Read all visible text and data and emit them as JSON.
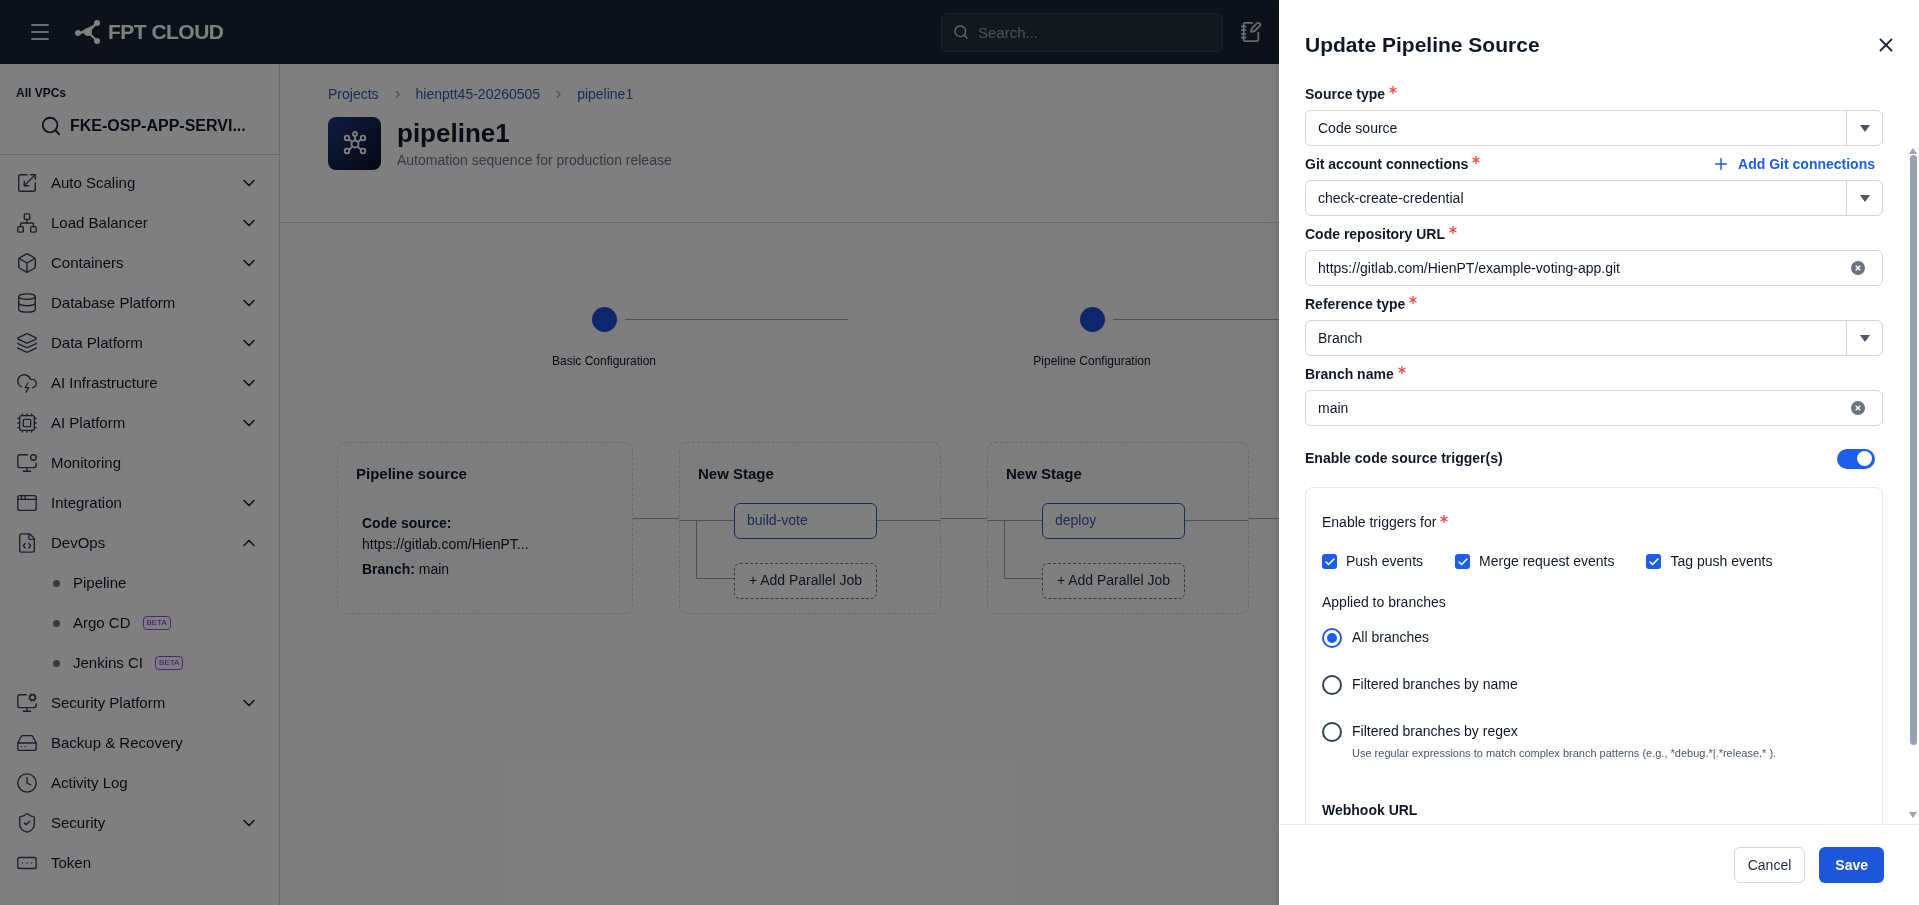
{
  "header": {
    "logo": "FPT CLOUD",
    "search": {
      "placeholder": "Search..."
    }
  },
  "sidebar": {
    "vpc_label": "All VPCs",
    "vpc_name": "FKE-OSP-APP-SERVI...",
    "items": [
      {
        "label": "Auto Scaling",
        "expanded": false
      },
      {
        "label": "Load Balancer",
        "expanded": false
      },
      {
        "label": "Containers",
        "expanded": false
      },
      {
        "label": "Database Platform",
        "expanded": false
      },
      {
        "label": "Data Platform",
        "expanded": false
      },
      {
        "label": "AI Infrastructure",
        "expanded": false
      },
      {
        "label": "AI Platform",
        "expanded": false
      },
      {
        "label": "Monitoring"
      },
      {
        "label": "Integration",
        "expanded": false
      },
      {
        "label": "DevOps",
        "expanded": true,
        "children": [
          {
            "label": "Pipeline"
          },
          {
            "label": "Argo CD",
            "badge": "BETA"
          },
          {
            "label": "Jenkins CI",
            "badge": "BETA"
          }
        ]
      },
      {
        "label": "Security Platform",
        "expanded": false
      },
      {
        "label": "Backup & Recovery"
      },
      {
        "label": "Activity Log"
      },
      {
        "label": "Security",
        "expanded": false
      },
      {
        "label": "Token"
      }
    ]
  },
  "breadcrumb": [
    "Projects",
    "hienptt45-20260505",
    "pipeline1"
  ],
  "page": {
    "title": "pipeline1",
    "subtitle": "Automation sequence for production release"
  },
  "stepper": [
    {
      "label": "Basic Configuration"
    },
    {
      "label": "Pipeline Configuration"
    }
  ],
  "pipeline": {
    "source": {
      "title": "Pipeline source",
      "code_source_label": "Code source:",
      "url": "https://gitlab.com/HienPT...",
      "branch": "**Branch:** main"
    },
    "stages": [
      {
        "title": "New Stage",
        "job": "build-vote",
        "add_job": "+ Add Parallel Job"
      },
      {
        "title": "New Stage",
        "job": "deploy",
        "add_job": "+ Add Parallel Job"
      }
    ]
  },
  "drawer": {
    "title": "Update Pipeline Source",
    "fields": [
      {
        "kind": "select",
        "label": "Source type",
        "required": true,
        "value": "Code source"
      },
      {
        "kind": "select",
        "label": "Git account connections",
        "required": true,
        "value": "check-create-credential",
        "action": "Add Git connections"
      },
      {
        "kind": "text",
        "label": "Code repository URL",
        "required": true,
        "value": "https://gitlab.com/HienPT/example-voting-app.git"
      },
      {
        "kind": "select",
        "label": "Reference type",
        "required": true,
        "value": "Branch"
      },
      {
        "kind": "text",
        "label": "Branch name",
        "required": true,
        "value": "main"
      }
    ],
    "trigger_toggle": {
      "label": "Enable code source trigger(s)",
      "on": true
    },
    "triggers": {
      "label": "Enable triggers for",
      "required": true,
      "events": [
        {
          "label": "Push events",
          "checked": true
        },
        {
          "label": "Merge request events",
          "checked": true
        },
        {
          "label": "Tag push events",
          "checked": true
        }
      ],
      "branches_label": "Applied to branches",
      "branches": [
        {
          "label": "All branches",
          "selected": true
        },
        {
          "label": "Filtered branches by name",
          "selected": false
        },
        {
          "label": "Filtered branches by regex",
          "selected": false,
          "hint": "Use regular expressions to match complex branch patterns (e.g., *debug.*|.*release.* )."
        }
      ],
      "webhook_label": "Webhook URL"
    },
    "buttons": {
      "cancel": "Cancel",
      "save": "Save"
    }
  }
}
